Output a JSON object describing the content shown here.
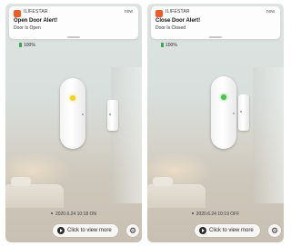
{
  "screens": [
    {
      "notification": {
        "app_name": "ILIFESTAR",
        "time_ago": "now",
        "title": "Open Door Alert!",
        "body": "Door Is Open",
        "app_icon": "app-logo-icon"
      },
      "battery_label": "100%",
      "sensor_led_color": "#f2d31d",
      "event_text": "2020.6.24 10:18 ON",
      "view_more_label": "Click to view more"
    },
    {
      "notification": {
        "app_name": "ILIFESTAR",
        "time_ago": "now",
        "title": "Close Door Alert!",
        "body": "Door Is Closed",
        "app_icon": "app-logo-icon"
      },
      "battery_label": "100%",
      "sensor_led_color": "#4cc24f",
      "event_text": "2020.6.24 10:19 OFF",
      "view_more_label": "Click to view more"
    }
  ],
  "colors": {
    "brand": "#f05b23",
    "battery": "#3aa84b"
  }
}
